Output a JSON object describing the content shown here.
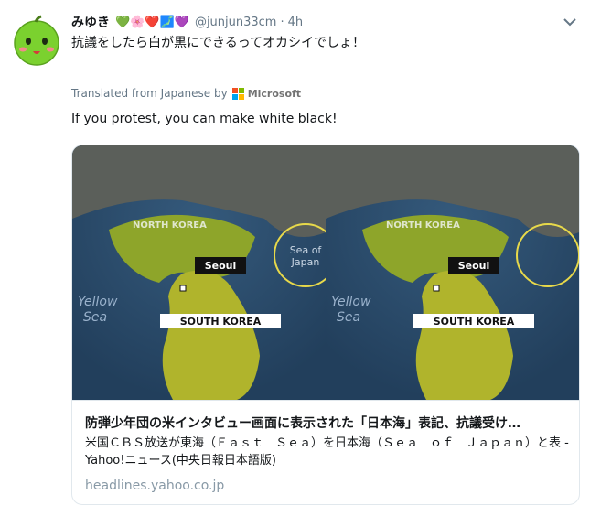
{
  "user": {
    "name": "みゆき",
    "emoji": "💚🌸❤️🗾💜",
    "handle": "@junjun33cm",
    "time": "4h",
    "avatar_icon": "green-apple-character"
  },
  "tweet": {
    "text": "抗議をしたら白が黒にできるってオカシイでしょ！"
  },
  "translation": {
    "label": "Translated from Japanese by",
    "provider": "Microsoft",
    "text": "If you protest, you can make white black!"
  },
  "card": {
    "title": "防弾少年団の米インタビュー画面に表示された「日本海」表記、抗議受け…",
    "description": "米国ＣＢＳ放送が東海（Ｅａｓｔ　Ｓｅａ）を日本海（Ｓｅａ　ｏｆ　Ｊａｐａｎ）と表 - Yahoo!ニュース(中央日報日本語版)",
    "domain": "headlines.yahoo.co.jp",
    "image": {
      "left_panel": {
        "north_label": "NORTH KOREA",
        "south_label": "SOUTH KOREA",
        "seoul_label": "Seoul",
        "yellow_sea_label": "Yellow\nSea",
        "sea_of_japan_label": "Sea of\nJapan"
      },
      "right_panel": {
        "north_label": "NORTH KOREA",
        "south_label": "SOUTH KOREA",
        "seoul_label": "Seoul",
        "yellow_sea_label": "Yellow\nSea"
      }
    }
  },
  "colors": {
    "green": "#77b255",
    "ocean": "#2d4e6c",
    "land": "#a8b32a"
  }
}
